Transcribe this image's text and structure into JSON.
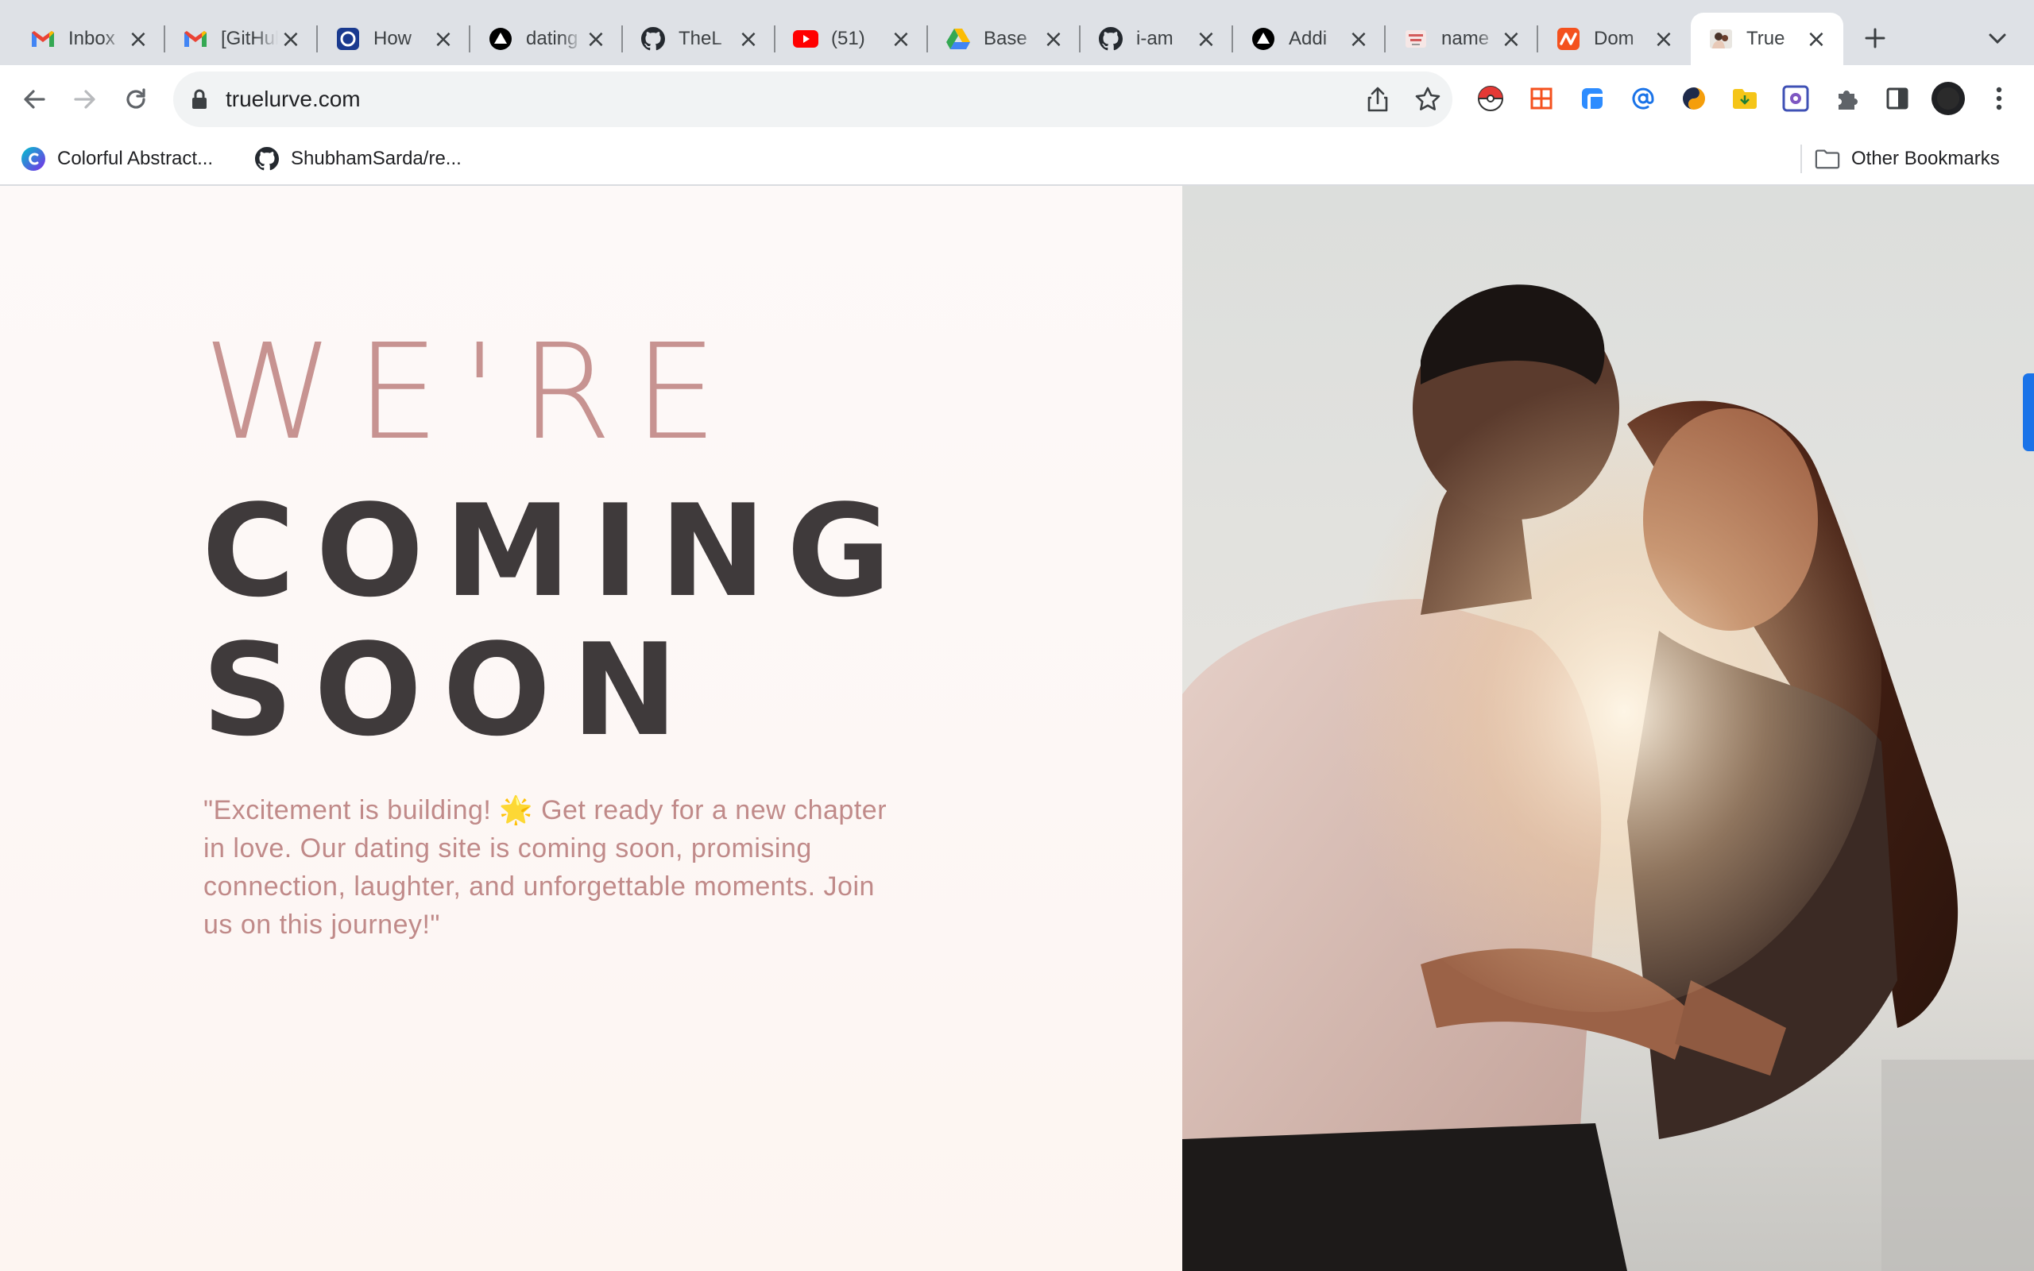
{
  "browser": {
    "tabs": [
      {
        "title": "Inbox",
        "icon": "gmail-icon"
      },
      {
        "title": "[GitHub]",
        "icon": "gmail-icon"
      },
      {
        "title": "How",
        "icon": "pocket-style-icon"
      },
      {
        "title": "dating",
        "icon": "vercel-icon"
      },
      {
        "title": "TheL",
        "icon": "github-icon"
      },
      {
        "title": "(51)",
        "icon": "youtube-icon"
      },
      {
        "title": "Base",
        "icon": "google-drive-icon"
      },
      {
        "title": "i-am",
        "icon": "github-icon"
      },
      {
        "title": "Addi",
        "icon": "vercel-icon"
      },
      {
        "title": "name",
        "icon": "site-logo-icon"
      },
      {
        "title": "Dom",
        "icon": "namecheap-icon"
      },
      {
        "title": "True",
        "icon": "site-photo-icon",
        "active": true
      }
    ],
    "url": "truelurve.com",
    "bookmarks": [
      {
        "label": "Colorful Abstract...",
        "icon": "canva-icon"
      },
      {
        "label": "ShubhamSarda/re...",
        "icon": "github-icon"
      }
    ],
    "other_bookmarks": "Other Bookmarks"
  },
  "page": {
    "headline_line1": "WE'RE",
    "headline_line2": "COMING",
    "headline_line3": "SOON",
    "tagline": "\"Excitement is building! 🌟 Get ready for a new chapter in love. Our dating site is coming soon, promising connection, laughter, and unforgettable moments. Join us on this journey!\"",
    "colors": {
      "accent": "#c79391",
      "headline_dark": "#3f3a3b",
      "background": "#fdf8f6"
    }
  }
}
